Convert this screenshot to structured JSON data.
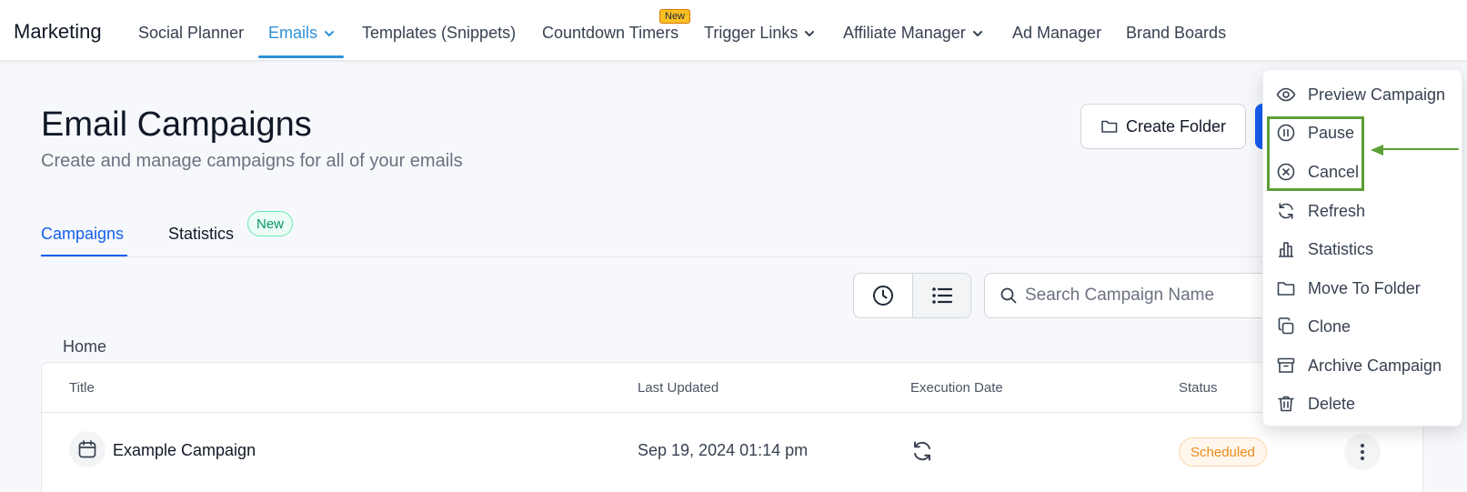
{
  "nav": {
    "brand": "Marketing",
    "items": [
      "Social Planner",
      "Emails",
      "Templates (Snippets)",
      "Countdown Timers",
      "Trigger Links",
      "Affiliate Manager",
      "Ad Manager",
      "Brand Boards"
    ],
    "new_tag": "New",
    "active_color": "#2e90d6"
  },
  "page": {
    "title": "Email Campaigns",
    "subtitle": "Create and manage campaigns for all of your emails",
    "create_folder_label": "Create Folder"
  },
  "tabs": {
    "campaigns": "Campaigns",
    "statistics": "Statistics",
    "new_pill": "New"
  },
  "toolbar": {
    "search_placeholder": "Search Campaign Name"
  },
  "breadcrumb": {
    "home": "Home"
  },
  "table": {
    "headers": {
      "title": "Title",
      "last_updated": "Last Updated",
      "execution_date": "Execution Date",
      "status": "Status"
    },
    "rows": [
      {
        "title": "Example Campaign",
        "last_updated": "Sep 19, 2024 01:14 pm",
        "status": "Scheduled"
      }
    ]
  },
  "menu": {
    "items": [
      "Preview Campaign",
      "Pause",
      "Cancel",
      "Refresh",
      "Statistics",
      "Move To Folder",
      "Clone",
      "Archive Campaign",
      "Delete"
    ]
  },
  "colors": {
    "primary": "#155eef",
    "highlight": "#5b9e35",
    "status_scheduled": "#ea8a1a"
  }
}
